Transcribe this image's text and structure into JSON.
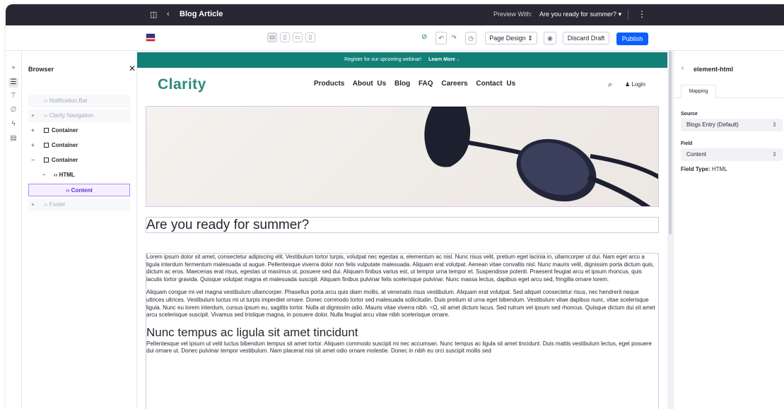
{
  "topbar": {
    "title": "Blog Article",
    "preview_label": "Preview With:",
    "preview_value": "Are you ready for summer?"
  },
  "toolbar": {
    "page_design_label": "Page Design",
    "discard_label": "Discard Draft",
    "publish_label": "Publish"
  },
  "browser": {
    "title": "Browser",
    "items": [
      {
        "label": "Notification Bar"
      },
      {
        "label": "Clarity Navigation"
      },
      {
        "label": "Container"
      },
      {
        "label": "Container"
      },
      {
        "label": "Container"
      },
      {
        "label": "HTML"
      },
      {
        "label": "Content"
      },
      {
        "label": "Footer"
      }
    ]
  },
  "site": {
    "banner_text": "Register for our upcoming webinar!",
    "banner_link": "Learn More→",
    "logo": "Clarity",
    "nav": [
      "Products",
      "About Us",
      "Blog",
      "FAQ",
      "Careers",
      "Contact Us"
    ],
    "login_label": "Login",
    "headline": "Are you ready for summer?",
    "paragraphs": [
      "Lorem ipsum dolor sit amet, consectetur adipiscing elit. Vestibulum tortor turpis, volutpat nec egestas a, elementum ac nisl. Nunc risus velit, pretium eget lacinia in, ullamcorper ut dui. Nam eget arcu a ligula interdum fermentum malesuada ut augue. Pellentesque viverra dolor non felis vulputate malesuada. Aliquam erat volutpat. Aenean vitae convallis nisl. Nunc mauris velit, dignissim porta dictum quis, dictum ac eros. Maecenas erat risus, egestas ut maximus ut, posuere sed dui. Aliquam finibus varius est, ut tempor urna tempor et. Suspendisse potenti. Praesent feugiat arcu et ipsum rhoncus, quis iaculis tortor gravida. Quisque volutpat magna et malesuada suscipit. Aliquam finibus pulvinar felis scelerisque pulvinar. Nunc massa lectus, dapibus eget arcu sed, fringilla ornare lorem.",
      "Aliquam congue mi vel magna vestibulum ullamcorper. Phasellus porta arcu quis diam mollis, at venenatis risus vestibulum. Aliquam erat volutpat. Sed aliquet consectetur risus, nec hendrerit neque ultrices ultrices. Vestibulum luctus mi ut turpis imperdiet ornare. Donec commodo tortor sed malesuada sollicitudin. Duis pretium id urna eget bibendum. Vestibulum vitae dapibus nunc, vitae scelerisque ligula. Nunc eu lorem interdum, cursus ipsum eu, sagittis tortor. Nulla at dignissim odio. Mauris vitae viverra nibh. ≈Ω, sit amet dictum lacus. Sed rutrum vel ipsum sed rhoncus. Quisque dictum dui sit amet arcu scelerisque suscipit. Vivamus sed tristique magna, in posuere dolor. Nulla feugiat arcu vitae nibh scelerisque ornare."
    ],
    "subheading": "Nunc tempus ac ligula sit amet tincidunt",
    "paragraph3": "Pellentesque vel ipsum ut velit luctus bibendum tempus sit amet tortor. Aliquam commodo suscipit mi nec accumsan. Nunc tempus ac ligula sit amet tincidunt. Duis mattis vestibulum lectus, eget posuere dui ornare ut. Donec pulvinar tempor vestibulum. Nam placerat nisi sit amet odio ornare molestie. Donec in nibh eu orci suscipit mollis sed"
  },
  "panel": {
    "title": "element-html",
    "tab": "Mapping",
    "source_label": "Source",
    "source_value": "Blogs Entry (Default)",
    "field_label": "Field",
    "field_value": "Content",
    "field_type_label": "Field Type:",
    "field_type_value": "HTML"
  },
  "colors": {
    "topbar": "#272833",
    "publish": "#0b5fff",
    "banner": "#138078",
    "logo": "#2d8a7e",
    "selection": "#b388ff"
  }
}
